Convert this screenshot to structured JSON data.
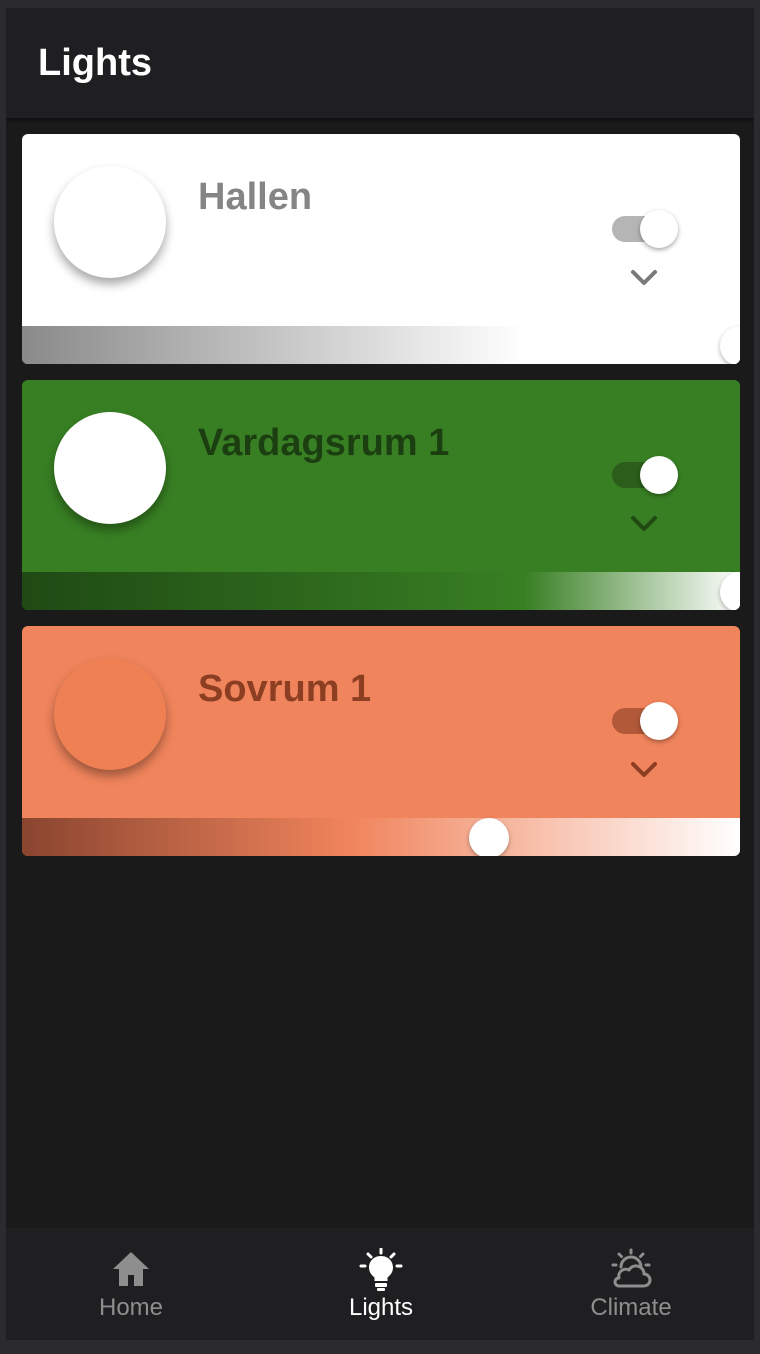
{
  "header": {
    "title": "Lights"
  },
  "lights": [
    {
      "name": "Hallen",
      "is_on": true,
      "brightness": 1.0,
      "colors": {
        "card_bg": "#ffffff",
        "text": "#858585",
        "bulb": "#ffffff",
        "toggle_track": "#b5b5b5",
        "chevron": "#7a7a7a",
        "gradient_start": "#8a8a8a",
        "gradient_end": "#ffffff"
      }
    },
    {
      "name": "Vardagsrum 1",
      "is_on": true,
      "brightness": 1.0,
      "colors": {
        "card_bg": "#387f23",
        "text": "#1c3f11",
        "bulb": "#ffffff",
        "toggle_track": "#2b5e1a",
        "chevron": "#1f4a14",
        "gradient_start": "#1f4a14",
        "gradient_end": "#ffffff"
      }
    },
    {
      "name": "Sovrum 1",
      "is_on": true,
      "brightness": 0.65,
      "colors": {
        "card_bg": "#f0845c",
        "text": "#8c3e22",
        "bulb": "#ee8054",
        "toggle_track": "#b2593a",
        "chevron": "#8c3e22",
        "gradient_start": "#8a452f",
        "gradient_end": "#ffffff"
      }
    }
  ],
  "nav": {
    "items": [
      {
        "label": "Home",
        "icon": "home-icon",
        "active": false
      },
      {
        "label": "Lights",
        "icon": "lightbulb-icon",
        "active": true
      },
      {
        "label": "Climate",
        "icon": "weather-partly-cloudy-icon",
        "active": false
      }
    ],
    "colors": {
      "active": "#ffffff",
      "inactive": "#8e8e8e"
    }
  }
}
